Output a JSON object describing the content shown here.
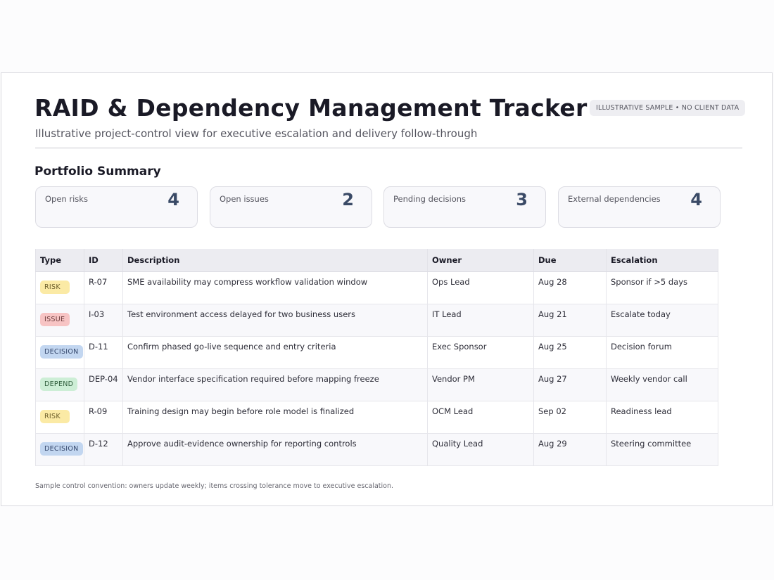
{
  "header": {
    "title": "RAID & Dependency Management Tracker",
    "subtitle": "Illustrative project-control view for executive escalation and delivery follow-through",
    "badge": "ILLUSTRATIVE SAMPLE • NO CLIENT DATA"
  },
  "summary": {
    "title": "Portfolio Summary",
    "cards": [
      {
        "label": "Open risks",
        "value": "4"
      },
      {
        "label": "Open issues",
        "value": "2"
      },
      {
        "label": "Pending decisions",
        "value": "3"
      },
      {
        "label": "External dependencies",
        "value": "4"
      }
    ]
  },
  "table": {
    "columns": [
      "Type",
      "ID",
      "Description",
      "Owner",
      "Due",
      "Escalation"
    ],
    "rows": [
      {
        "type": "RISK",
        "type_kind": "risk",
        "id": "R-07",
        "description": "SME availability may compress workflow validation window",
        "owner": "Ops Lead",
        "due": "Aug 28",
        "escalation": "Sponsor if >5 days"
      },
      {
        "type": "ISSUE",
        "type_kind": "issue",
        "id": "I-03",
        "description": "Test environment access delayed for two business users",
        "owner": "IT Lead",
        "due": "Aug 21",
        "escalation": "Escalate today"
      },
      {
        "type": "DECISION",
        "type_kind": "decision",
        "id": "D-11",
        "description": "Confirm phased go-live sequence and entry criteria",
        "owner": "Exec Sponsor",
        "due": "Aug 25",
        "escalation": "Decision forum"
      },
      {
        "type": "DEPEND",
        "type_kind": "depend",
        "id": "DEP-04",
        "description": "Vendor interface specification required before mapping freeze",
        "owner": "Vendor PM",
        "due": "Aug 27",
        "escalation": "Weekly vendor call"
      },
      {
        "type": "RISK",
        "type_kind": "risk",
        "id": "R-09",
        "description": "Training design may begin before role model is finalized",
        "owner": "OCM Lead",
        "due": "Sep 02",
        "escalation": "Readiness lead"
      },
      {
        "type": "DECISION",
        "type_kind": "decision",
        "id": "D-12",
        "description": "Approve audit-evidence ownership for reporting controls",
        "owner": "Quality Lead",
        "due": "Aug 29",
        "escalation": "Steering committee"
      }
    ]
  },
  "footnote": "Sample control convention: owners update weekly; items crossing tolerance move to executive escalation.",
  "colors": {
    "risk": "#fbeaa5",
    "issue": "#f7c4c4",
    "decision": "#c2d6f0",
    "depend": "#cdeed6",
    "metric": "#3a4a66"
  }
}
